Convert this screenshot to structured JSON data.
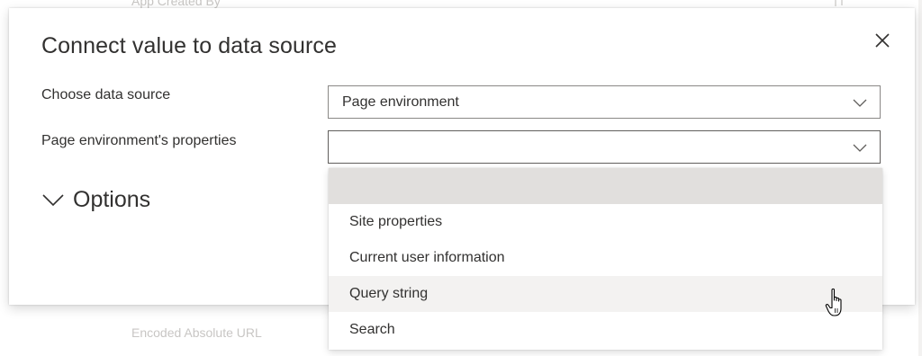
{
  "background": {
    "top_text": "App Created By",
    "bottom_text": "Encoded Absolute URL"
  },
  "dialog": {
    "title": "Connect value to data source",
    "close_icon": "close-icon",
    "fields": {
      "data_source": {
        "label": "Choose data source",
        "value": "Page environment"
      },
      "properties": {
        "label": "Page environment's properties",
        "value": ""
      }
    },
    "options": {
      "label": "Options",
      "expanded": false
    }
  },
  "dropdown_list": {
    "items": [
      {
        "label": "",
        "state": "selected"
      },
      {
        "label": "Site properties",
        "state": "normal"
      },
      {
        "label": "Current user information",
        "state": "normal"
      },
      {
        "label": "Query string",
        "state": "hover"
      },
      {
        "label": "Search",
        "state": "normal"
      }
    ]
  },
  "colors": {
    "text": "#323130",
    "border": "#8a8886",
    "selected_item_bg": "#e1dfdd",
    "hover_item_bg": "#f3f2f1",
    "faded_text": "#c8c6c4"
  }
}
